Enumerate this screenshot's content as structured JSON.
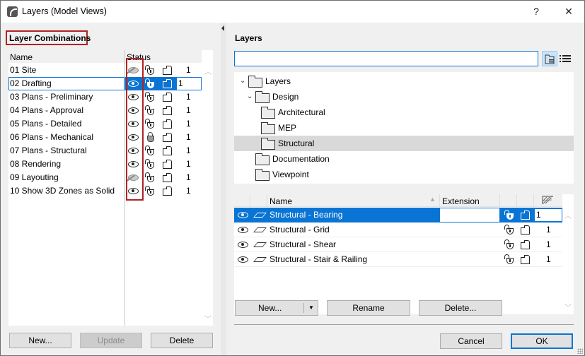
{
  "window": {
    "title": "Layers (Model Views)",
    "help_label": "?",
    "close_label": "✕"
  },
  "combinations": {
    "title": "Layer Combinations",
    "headers": {
      "name": "Name",
      "status": "Status"
    },
    "rows": [
      {
        "name": "01 Site",
        "visible": false,
        "locked": false,
        "value": "1",
        "selected": false
      },
      {
        "name": "02 Drafting",
        "visible": true,
        "locked": false,
        "value": "1",
        "selected": true
      },
      {
        "name": "03 Plans - Preliminary",
        "visible": true,
        "locked": false,
        "value": "1",
        "selected": false
      },
      {
        "name": "04 Plans - Approval",
        "visible": true,
        "locked": false,
        "value": "1",
        "selected": false
      },
      {
        "name": "05 Plans - Detailed",
        "visible": true,
        "locked": false,
        "value": "1",
        "selected": false
      },
      {
        "name": "06 Plans - Mechanical",
        "visible": true,
        "locked": true,
        "value": "1",
        "selected": false
      },
      {
        "name": "07 Plans - Structural",
        "visible": true,
        "locked": false,
        "value": "1",
        "selected": false
      },
      {
        "name": "08 Rendering",
        "visible": true,
        "locked": false,
        "value": "1",
        "selected": false
      },
      {
        "name": "09 Layouting",
        "visible": false,
        "locked": false,
        "value": "1",
        "selected": false
      },
      {
        "name": "10 Show 3D Zones as Solid",
        "visible": true,
        "locked": false,
        "value": "1",
        "selected": false
      }
    ],
    "buttons": {
      "new": "New...",
      "update": "Update",
      "delete": "Delete"
    }
  },
  "layers": {
    "title": "Layers",
    "search": {
      "value": "",
      "placeholder": ""
    },
    "tree": [
      {
        "label": "Layers",
        "depth": 0,
        "expanded": true,
        "icon": "layers-folder-icon",
        "selected": false
      },
      {
        "label": "Design",
        "depth": 1,
        "expanded": true,
        "icon": "folder-icon",
        "selected": false
      },
      {
        "label": "Architectural",
        "depth": 2,
        "icon": "folder-icon",
        "selected": false
      },
      {
        "label": "MEP",
        "depth": 2,
        "icon": "folder-icon",
        "selected": false
      },
      {
        "label": "Structural",
        "depth": 2,
        "icon": "folder-icon",
        "selected": true
      },
      {
        "label": "Documentation",
        "depth": 1,
        "icon": "folder-icon",
        "selected": false
      },
      {
        "label": "Viewpoint",
        "depth": 1,
        "icon": "folder-icon",
        "selected": false
      }
    ],
    "table": {
      "headers": {
        "name": "Name",
        "extension": "Extension"
      },
      "rows": [
        {
          "name": "Structural - Bearing",
          "extension": "",
          "value": "1",
          "selected": true
        },
        {
          "name": "Structural - Grid",
          "extension": "",
          "value": "1",
          "selected": false
        },
        {
          "name": "Structural - Shear",
          "extension": "",
          "value": "1",
          "selected": false
        },
        {
          "name": "Structural - Stair & Railing",
          "extension": "",
          "value": "1",
          "selected": false
        }
      ]
    },
    "buttons": {
      "new": "New...",
      "rename": "Rename",
      "delete": "Delete..."
    }
  },
  "footer": {
    "cancel": "Cancel",
    "ok": "OK"
  },
  "colors": {
    "accent": "#0a74d4",
    "highlight_box": "#b22222",
    "tree_selection": "#d9d9d9"
  }
}
